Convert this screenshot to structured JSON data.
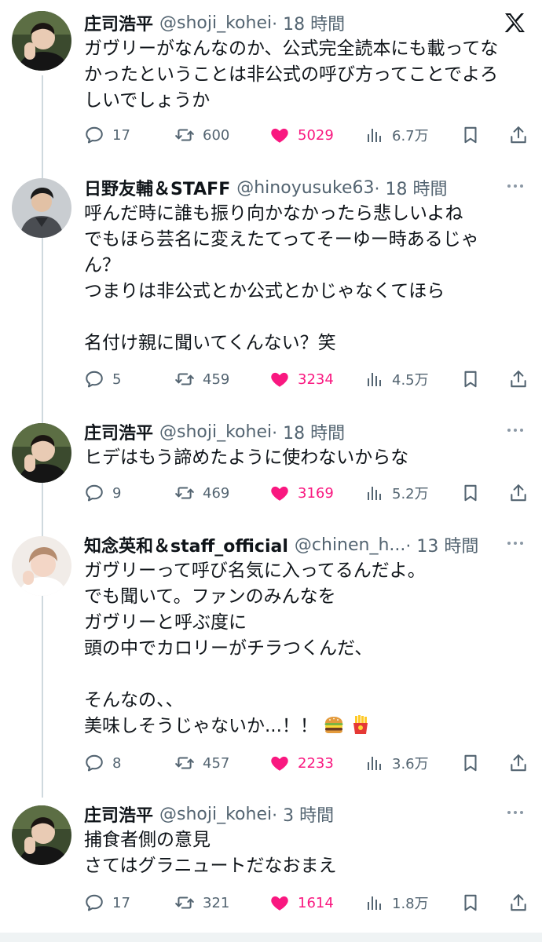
{
  "brand": {
    "logo": "X",
    "accent": "#1d9bf0",
    "like_color": "#f91880"
  },
  "tweets": [
    {
      "name": "庄司浩平",
      "handle": "@shoji_kohei",
      "time": "· 18 時間",
      "lines": [
        "ガヴリーがなんなのか、公式完全読本にも載ってな",
        "かったということは非公式の呼び方ってことでよろ",
        "しいでしょうか"
      ],
      "stats": {
        "replies": "17",
        "reposts": "600",
        "likes": "5029",
        "views": "6.7万"
      }
    },
    {
      "name": "日野友輔＆STAFF",
      "handle": "@hinoyusuke63",
      "time": "· 18 時間",
      "lines": [
        "呼んだ時に誰も振り向かなかったら悲しいよね",
        "でもほら芸名に変えたてってそーゆー時あるじゃ",
        "ん？",
        "つまりは非公式とか公式とかじゃなくてほら",
        "",
        "名付け親に聞いてくんない？笑"
      ],
      "stats": {
        "replies": "5",
        "reposts": "459",
        "likes": "3234",
        "views": "4.5万"
      }
    },
    {
      "name": "庄司浩平",
      "handle": "@shoji_kohei",
      "time": "· 18 時間",
      "lines": [
        "ヒデはもう諦めたように使わないからな"
      ],
      "stats": {
        "replies": "9",
        "reposts": "469",
        "likes": "3169",
        "views": "5.2万"
      }
    },
    {
      "name": "知念英和＆staff_official",
      "handle": "@chinen_h...",
      "time": "· 13 時間",
      "lines": [
        "ガヴリーって呼び名気に入ってるんだよ。",
        "でも聞いて。ファンのみんなを",
        "ガヴリーと呼ぶ度に",
        "頭の中でカロリーがチラつくんだ、",
        "",
        "そんなの、、",
        "美味しそうじゃないか...！！"
      ],
      "emojis": [
        "hamburger-icon",
        "fries-icon"
      ],
      "stats": {
        "replies": "8",
        "reposts": "457",
        "likes": "2233",
        "views": "3.6万"
      }
    },
    {
      "name": "庄司浩平",
      "handle": "@shoji_kohei",
      "time": "· 3 時間",
      "lines": [
        "捕食者側の意見",
        "さてはグラニュートだなおまえ"
      ],
      "stats": {
        "replies": "17",
        "reposts": "321",
        "likes": "1614",
        "views": "1.8万"
      }
    }
  ]
}
